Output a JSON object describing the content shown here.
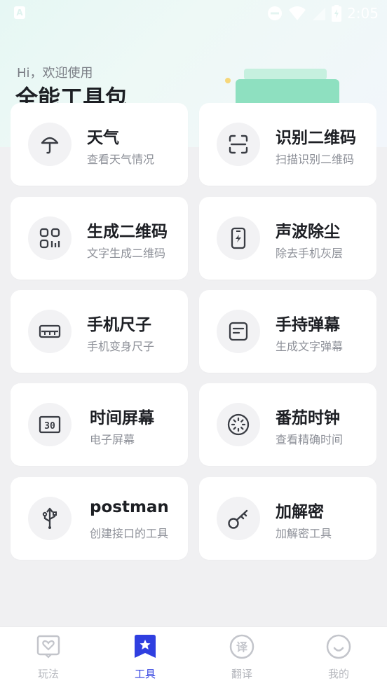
{
  "status_bar": {
    "time": "2:05"
  },
  "header": {
    "greeting": "Hi，欢迎使用",
    "title": "全能工具包"
  },
  "tools": [
    {
      "name": "天气",
      "desc": "查看天气情况",
      "icon": "umbrella-icon"
    },
    {
      "name": "识别二维码",
      "desc": "扫描识别二维码",
      "icon": "scan-icon"
    },
    {
      "name": "生成二维码",
      "desc": "文字生成二维码",
      "icon": "qr-code-icon"
    },
    {
      "name": "声波除尘",
      "desc": "除去手机灰层",
      "icon": "phone-charge-icon"
    },
    {
      "name": "手机尺子",
      "desc": "手机变身尺子",
      "icon": "ruler-icon"
    },
    {
      "name": "手持弹幕",
      "desc": "生成文字弹幕",
      "icon": "barrage-icon"
    },
    {
      "name": "时间屏幕",
      "desc": "电子屏幕",
      "icon": "digital-clock-icon"
    },
    {
      "name": "番茄时钟",
      "desc": "查看精确时间",
      "icon": "timer-icon"
    },
    {
      "name": "postman",
      "desc": "创建接口的工具",
      "icon": "usb-icon"
    },
    {
      "name": "加解密",
      "desc": "加解密工具",
      "icon": "key-icon"
    }
  ],
  "nav": [
    {
      "label": "玩法",
      "icon": "heart-frame-icon",
      "active": false
    },
    {
      "label": "工具",
      "icon": "star-bookmark-icon",
      "active": true
    },
    {
      "label": "翻译",
      "icon": "translate-icon",
      "active": false
    },
    {
      "label": "我的",
      "icon": "smile-icon",
      "active": false
    }
  ],
  "colors": {
    "accent": "#2f3fe0",
    "icon_gray": "#3a3d44",
    "nav_gray": "#c3c5cb"
  }
}
